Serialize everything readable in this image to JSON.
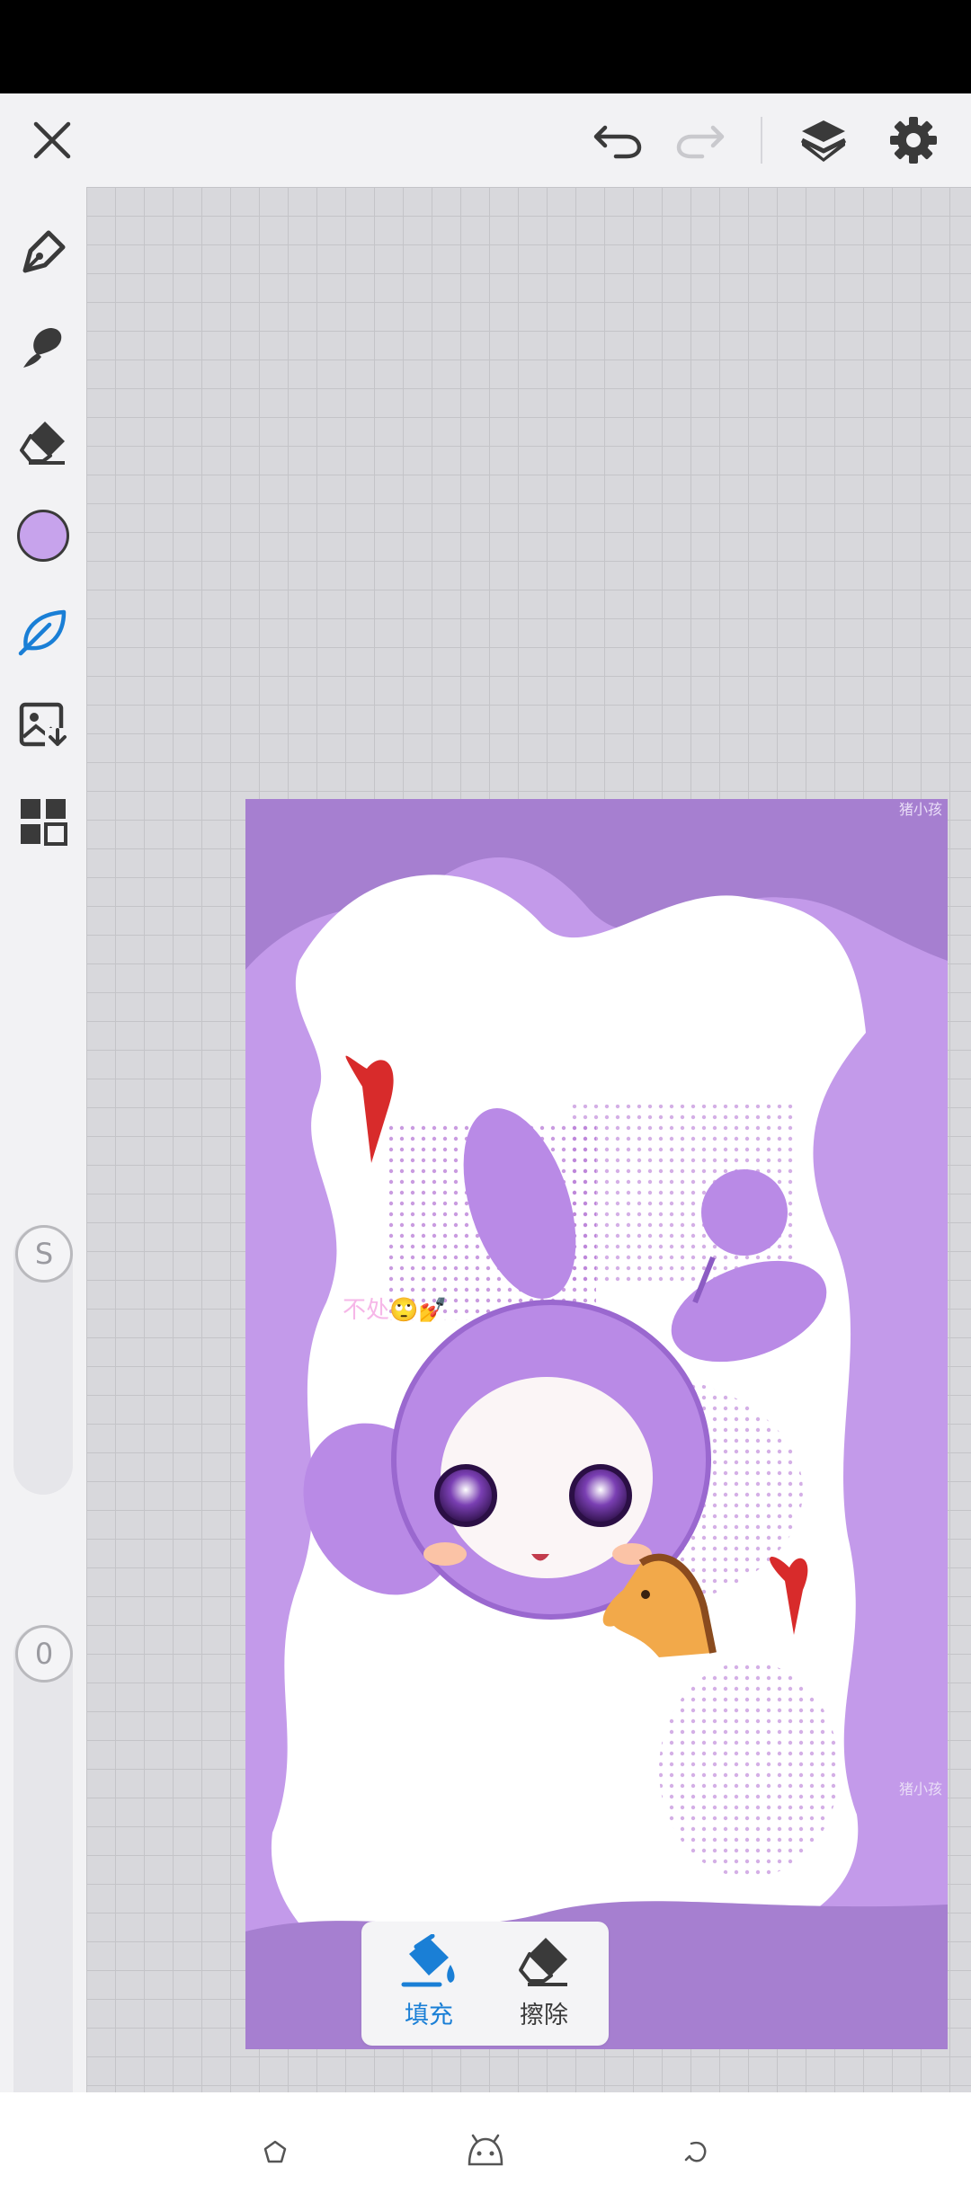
{
  "app": {
    "accent_color": "#1a7fd6",
    "brush_color": "#c7a3ec",
    "canvas_bg": "#a67fd0"
  },
  "topbar": {
    "close_icon": "close-icon",
    "undo_icon": "undo-icon",
    "redo_icon": "redo-icon",
    "layers_icon": "layers-icon",
    "settings_icon": "gear-icon"
  },
  "sidebar": {
    "tools": [
      "pen-tool",
      "brush-tool",
      "eraser-tool",
      "color-picker",
      "leaf-brush-tool",
      "image-import-tool",
      "templates-tool"
    ],
    "size_slider_label": "S",
    "opacity_slider_label": "0"
  },
  "canvas": {
    "watermark_top": "猪小孩",
    "watermark_side": "猪小孩",
    "doodle_text": "不处🙄💅"
  },
  "fill_panel": {
    "fill_label": "填充",
    "erase_label": "擦除",
    "active": "fill"
  },
  "navbar": {
    "back_icon": "back-icon",
    "home_icon": "home-icon",
    "recents_icon": "recents-icon"
  }
}
